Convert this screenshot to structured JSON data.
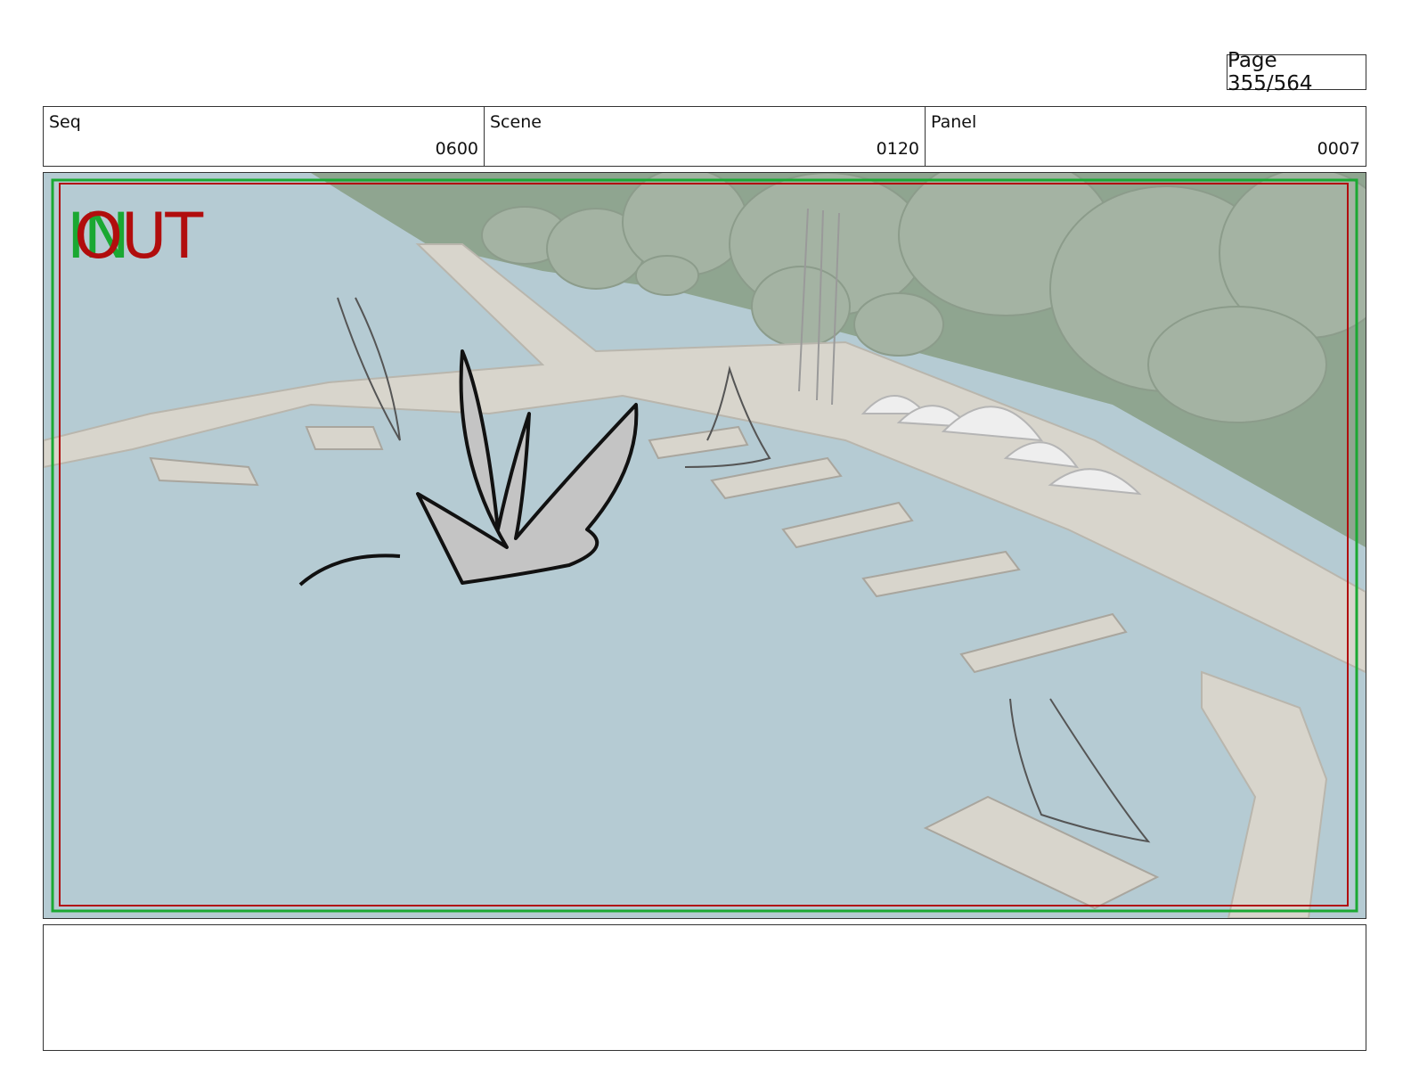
{
  "page": {
    "label": "Page 355/564"
  },
  "header": {
    "seq": {
      "label": "Seq",
      "value": "0600"
    },
    "scene": {
      "label": "Scene",
      "value": "0120"
    },
    "panel": {
      "label": "Panel",
      "value": "0007"
    }
  },
  "frame": {
    "in_label": "IN",
    "out_label": "OUT",
    "colors": {
      "safe_frame": "#1aa832",
      "action_frame": "#b10d0d",
      "water": "#b5cbd3",
      "land": "#8fa590",
      "dock": "#d8d5cc"
    }
  },
  "notes": {
    "text": ""
  }
}
